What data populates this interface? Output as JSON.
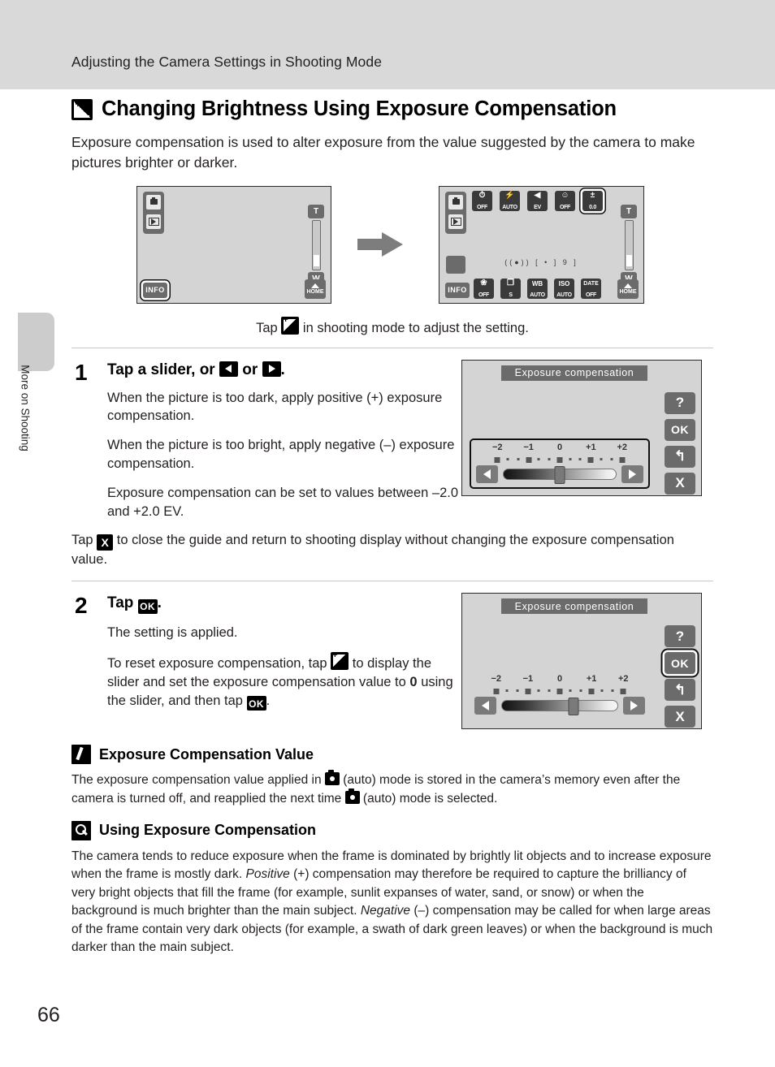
{
  "header": {
    "running_head": "Adjusting the Camera Settings in Shooting Mode"
  },
  "sidebar": {
    "tab_label": "More on Shooting"
  },
  "page": {
    "number": "66"
  },
  "section": {
    "title": "Changing Brightness Using Exposure Compensation",
    "icon": "exposure-compensation-icon",
    "intro": "Exposure compensation is used to alter exposure from the value suggested by the camera to make pictures brighter or darker.",
    "caption_before": "Tap",
    "caption_after": "in shooting mode to adjust the setting."
  },
  "camera_screen_a": {
    "info_label": "INFO",
    "home_label": "HOME",
    "zoom_tele": "T",
    "zoom_wide": "W"
  },
  "camera_screen_b": {
    "info_label": "INFO",
    "home_label": "HOME",
    "zoom_tele": "T",
    "zoom_wide": "W",
    "top_icons": [
      {
        "name": "self-timer",
        "glyph": "⏱",
        "label": "OFF",
        "selected": false
      },
      {
        "name": "flash-mode",
        "glyph": "⚡",
        "label": "AUTO",
        "selected": false
      },
      {
        "name": "flash-exposure",
        "glyph": "◀",
        "label": "EV",
        "selected": false
      },
      {
        "name": "smile-timer",
        "glyph": "☺",
        "label": "OFF",
        "selected": false
      },
      {
        "name": "exposure-compensation",
        "glyph": "±",
        "label": "0.0",
        "selected": true
      }
    ],
    "bottom_icons": [
      {
        "name": "macro-mode",
        "glyph": "❀",
        "label": "OFF"
      },
      {
        "name": "continuous",
        "glyph": "❐",
        "label": "S"
      },
      {
        "name": "white-balance",
        "glyph": "WB",
        "label": "AUTO"
      },
      {
        "name": "iso-sensitivity",
        "glyph": "ISO",
        "label": "AUTO"
      },
      {
        "name": "date-imprint",
        "glyph": "DATE",
        "label": "OFF"
      }
    ],
    "status_indicators": "((●))        [ • ]      9 ]"
  },
  "steps": [
    {
      "number": "1",
      "head_before": "Tap a slider, or",
      "head_mid": "or",
      "head_after": ".",
      "paragraphs": [
        "When the picture is too dark, apply positive (+) exposure compensation.",
        "When the picture is too bright, apply negative (–) exposure compensation.",
        "Exposure compensation can be set to values between –2.0 and +2.0 EV."
      ],
      "note_before": "Tap",
      "note_after": "to close the guide and return to shooting display without changing the exposure compensation value."
    },
    {
      "number": "2",
      "head_before": "Tap",
      "head_after": ".",
      "paragraphs": [
        "The setting is applied."
      ],
      "reset_text_1": "To reset exposure compensation, tap",
      "reset_text_2": "to display the slider and set the exposure compensation value to",
      "reset_bold": "0",
      "reset_text_3": "using the slider, and then tap",
      "reset_text_4": "."
    }
  ],
  "ev_dialog_1": {
    "title": "Exposure compensation",
    "buttons": [
      {
        "name": "help-button",
        "label": "?",
        "selected": false
      },
      {
        "name": "ok-button",
        "label": "OK",
        "selected": false
      },
      {
        "name": "back-button",
        "label": "↰",
        "selected": false
      },
      {
        "name": "close-button",
        "label": "X",
        "selected": false
      }
    ],
    "scale_labels": [
      "−2",
      "−1",
      "0",
      "+1",
      "+2"
    ],
    "slider_value": "0",
    "slider_percent": 50,
    "slider_framed": true
  },
  "ev_dialog_2": {
    "title": "Exposure compensation",
    "buttons": [
      {
        "name": "help-button",
        "label": "?",
        "selected": false
      },
      {
        "name": "ok-button",
        "label": "OK",
        "selected": true
      },
      {
        "name": "back-button",
        "label": "↰",
        "selected": false
      },
      {
        "name": "close-button",
        "label": "X",
        "selected": false
      }
    ],
    "scale_labels": [
      "−2",
      "−1",
      "0",
      "+1",
      "+2"
    ],
    "slider_value": "+0.6",
    "slider_percent": 62,
    "slider_framed": false
  },
  "notes": [
    {
      "icon": "pencil-note-icon",
      "title": "Exposure Compensation Value",
      "body_1": "The exposure compensation value applied in",
      "body_2": "(auto) mode is stored in the camera’s memory even after the camera is turned off, and reapplied the next time",
      "body_3": "(auto) mode is selected."
    },
    {
      "icon": "magnifier-note-icon",
      "title": "Using Exposure Compensation",
      "body_1": "The camera tends to reduce exposure when the frame is dominated by brightly lit objects and to increase exposure when the frame is mostly dark.",
      "em_1": "Positive",
      "body_2": "(+) compensation may therefore be required to capture the brilliancy of very bright objects that fill the frame (for example, sunlit expanses of water, sand, or snow) or when the background is much brighter than the main subject.",
      "em_2": "Negative",
      "body_3": "(–) compensation may be called for when large areas of the frame contain very dark objects (for example, a swath of dark green leaves) or when the background is much darker than the main subject."
    }
  ]
}
